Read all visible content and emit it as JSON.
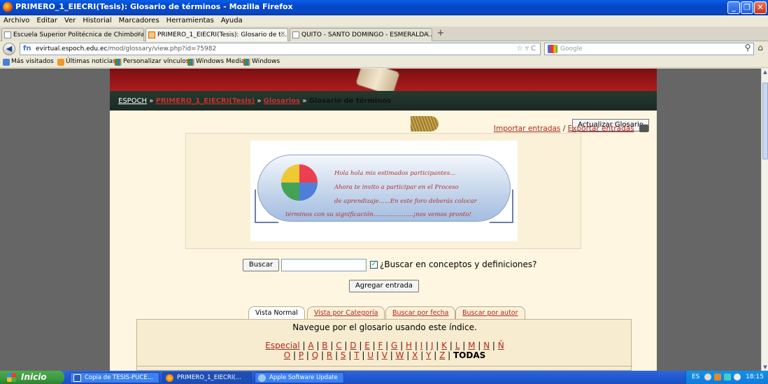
{
  "window": {
    "title": "PRIMERO_1_EIECRI(Tesis): Glosario de términos - Mozilla Firefox"
  },
  "menu": [
    "Archivo",
    "Editar",
    "Ver",
    "Historial",
    "Marcadores",
    "Herramientas",
    "Ayuda"
  ],
  "tabs": [
    {
      "label": "Escuela Superior Politécnica de Chimborazo"
    },
    {
      "label": "PRIMERO_1_EIECRI(Tesis): Glosario de t..."
    },
    {
      "label": "QUITO - SANTO DOMINGO - ESMERALDA..."
    }
  ],
  "nav": {
    "url_domain": "evirtual.espoch.edu.ec",
    "url_path": "/mod/glossary/view.php?id=75982",
    "search_placeholder": "Google"
  },
  "bookmarks": [
    "Más visitados",
    "Últimas noticias",
    "Personalizar vínculos",
    "Windows Media",
    "Windows"
  ],
  "breadcrumb": {
    "home": "ESPOCH",
    "course": "PRIMERO_1_EIECRI(Tesis)",
    "section": "Glosarios",
    "current": "Glosario de términos",
    "sep": "»"
  },
  "update_button": "Actualizar Glosario",
  "import_link": "Importar entradas",
  "export_link": "Exportar entradas",
  "link_separator": "/",
  "image_message": [
    "Hola hola mis estimados participantes...",
    "Ahora te invito a participar en el Proceso",
    "de aprendizaje......En este foro deberás colocar",
    "términos con su significación.....................¡nos vemos pronto!"
  ],
  "search": {
    "button": "Buscar",
    "value": "",
    "checkbox_checked": true,
    "checkbox_label": "¿Buscar en conceptos y definiciones?"
  },
  "add_entry_button": "Agregar entrada",
  "view_tabs": [
    "Vista Normal",
    "Vista por Categoría",
    "Buscar por fecha",
    "Buscar por autor"
  ],
  "index_hint": "Navegue por el glosario usando este índice.",
  "alphabet": {
    "special": "Especial",
    "row1": [
      "A",
      "B",
      "C",
      "D",
      "E",
      "F",
      "G",
      "H",
      "I",
      "J",
      "K",
      "L",
      "M",
      "N",
      "Ñ"
    ],
    "row2": [
      "O",
      "P",
      "Q",
      "R",
      "S",
      "T",
      "U",
      "V",
      "W",
      "X",
      "Y",
      "Z"
    ],
    "all": "TODAS"
  },
  "taskbar": {
    "start": "Inicio",
    "items": [
      "Copia de TESIS-PUCE...",
      "PRIMERO_1_EIECRI(...",
      "Apple Software Update"
    ],
    "lang": "ES",
    "clock": "18:15"
  }
}
